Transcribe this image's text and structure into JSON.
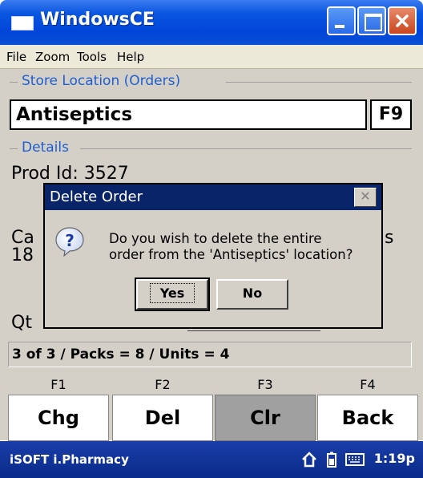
{
  "window": {
    "title": "WindowsCE"
  },
  "menu": [
    "File",
    "Zoom",
    "Tools",
    "Help"
  ],
  "store_location": {
    "legend": "Store Location (Orders)",
    "value": "Antiseptics",
    "lookup_key": "F9"
  },
  "details": {
    "legend": "Details",
    "prod_id": "Prod Id: 3527",
    "partial_left_1": "Ca",
    "partial_left_2": "18",
    "partial_right": "s",
    "partial_qty": "Qt"
  },
  "dialog": {
    "title": "Delete Order",
    "close_glyph": "✕",
    "message_line1": "Do you wish to delete the entire",
    "message_line2": "order from the 'Antiseptics' location?",
    "yes_label": "Yes",
    "no_label": "No"
  },
  "status": {
    "text": "3 of 3 / Packs = 8 / Units = 4"
  },
  "function_keys": [
    {
      "key": "F1",
      "label": "Chg",
      "pressed": false
    },
    {
      "key": "F2",
      "label": "Del",
      "pressed": false
    },
    {
      "key": "F3",
      "label": "Clr",
      "pressed": true
    },
    {
      "key": "F4",
      "label": "Back",
      "pressed": false
    }
  ],
  "taskbar": {
    "app_name": "iSOFT i.Pharmacy",
    "clock": "1:19p",
    "icons": [
      "home-icon",
      "battery-icon",
      "keyboard-icon"
    ]
  },
  "colors": {
    "titlebar": "#0045d8",
    "legend": "#1e5fd0",
    "dialog_title": "#0a246a",
    "taskbar": "#0a2a8a",
    "pressed_key": "#a0a0a0"
  }
}
